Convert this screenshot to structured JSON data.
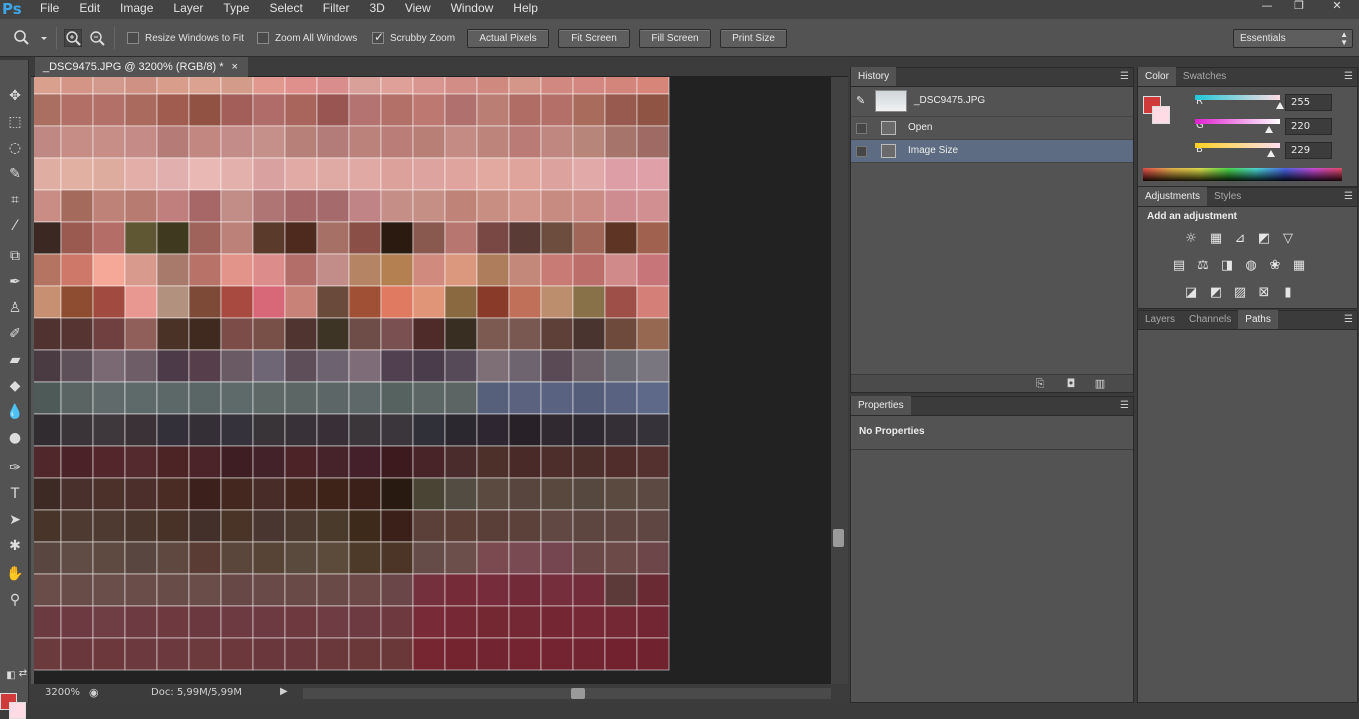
{
  "app": {
    "logo": "Ps"
  },
  "menu": [
    "File",
    "Edit",
    "Image",
    "Layer",
    "Type",
    "Select",
    "Filter",
    "3D",
    "View",
    "Window",
    "Help"
  ],
  "window_controls": {
    "minimize": "—",
    "restore": "❐",
    "close": "✕"
  },
  "options_bar": {
    "resize_windows_label": "Resize Windows to Fit",
    "resize_windows_checked": false,
    "zoom_all_label": "Zoom All Windows",
    "zoom_all_checked": false,
    "scrubby_zoom_label": "Scrubby Zoom",
    "scrubby_zoom_checked": true,
    "actual_pixels": "Actual Pixels",
    "fit_screen": "Fit Screen",
    "fill_screen": "Fill Screen",
    "print_size": "Print Size",
    "workspace": "Essentials"
  },
  "document": {
    "tab_title": "_DSC9475.JPG @ 3200% (RGB/8) *",
    "tab_close": "×",
    "zoom": "3200%",
    "doc_info": "Doc: 5,99M/5,99M"
  },
  "history_panel": {
    "tab": "History",
    "snapshot": "_DSC9475.JPG",
    "states": [
      {
        "label": "Open",
        "selected": false
      },
      {
        "label": "Image Size",
        "selected": true
      }
    ]
  },
  "properties_panel": {
    "tab": "Properties",
    "body": "No Properties"
  },
  "color_panel": {
    "tabs": [
      "Color",
      "Swatches"
    ],
    "foreground": "#d03a3a",
    "background": "#ffdce5",
    "r_label": "R",
    "r_value": "255",
    "g_label": "G",
    "g_value": "220",
    "b_label": "B",
    "b_value": "229"
  },
  "adjustments_panel": {
    "tabs": [
      "Adjustments",
      "Styles"
    ],
    "title": "Add an adjustment"
  },
  "layers_panel": {
    "tabs": [
      "Layers",
      "Channels",
      "Paths"
    ],
    "active_tab": "Paths"
  },
  "canvas_rows": [
    [
      "#d9a08e",
      "#d49586",
      "#d2998c",
      "#cf9183",
      "#d99d8c",
      "#dba292",
      "#d39b8a",
      "#e0988f",
      "#e0908c",
      "#d98e8d",
      "#d9a09a",
      "#dfa09a",
      "#d99690",
      "#d28d86",
      "#cf897f",
      "#d49688",
      "#d08881",
      "#d38780",
      "#d3847b",
      "#d88579"
    ],
    [
      "#ab6f62",
      "#b26f65",
      "#b37068",
      "#ab6a5e",
      "#a05c4f",
      "#925243",
      "#a35e5a",
      "#af6c68",
      "#a9645b",
      "#985551",
      "#b47270",
      "#b27068",
      "#bc7871",
      "#b0706e",
      "#bb7e74",
      "#b06d65",
      "#b47068",
      "#a96b5c",
      "#985a4e",
      "#8f5444"
    ],
    [
      "#c08883",
      "#c68d86",
      "#c68e86",
      "#c58b86",
      "#b57b76",
      "#c28781",
      "#c48c89",
      "#c58f8a",
      "#b7817a",
      "#b47c78",
      "#bb827c",
      "#bb7d77",
      "#b87f77",
      "#c48a84",
      "#bd847c",
      "#ba7b77",
      "#c08780",
      "#b8857a",
      "#a6746a",
      "#9e6a63"
    ],
    [
      "#e0ada3",
      "#e2b0a3",
      "#deab9f",
      "#e3ada8",
      "#e1b0ae",
      "#e9b8b4",
      "#e3b0ac",
      "#d9a2a0",
      "#e2aaa5",
      "#e0aaa4",
      "#e0a9a4",
      "#dba19a",
      "#dda39f",
      "#e0a49e",
      "#e2a9a1",
      "#dfa49c",
      "#dba29e",
      "#e1a9a8",
      "#de9ea6",
      "#e0a0a8"
    ],
    [
      "#c98d86",
      "#a46a5c",
      "#be8278",
      "#b87b72",
      "#c07f7c",
      "#a76767",
      "#c28d87",
      "#ae7574",
      "#a56767",
      "#a56a6b",
      "#c18486",
      "#c58f88",
      "#c68f85",
      "#bf8377",
      "#c88e82",
      "#d2958c",
      "#c88b82",
      "#c98b83",
      "#ce8c90",
      "#d18f92"
    ],
    [
      "#3b2822",
      "#9a5a50",
      "#b56e67",
      "#5f5633",
      "#3f391f",
      "#a0635b",
      "#bc8178",
      "#5a3a2a",
      "#4e2a1e",
      "#a77066",
      "#8a5048",
      "#2a1a10",
      "#89584f",
      "#b87670",
      "#7a4844",
      "#5a3b35",
      "#6c4d3e",
      "#a06658",
      "#5e3424",
      "#a0624e"
    ],
    [
      "#b57361",
      "#cd7868",
      "#f6a898",
      "#d89a8c",
      "#a87a6c",
      "#b87268",
      "#e2948a",
      "#dc8c8a",
      "#b46e6a",
      "#c28c88",
      "#b58464",
      "#b48052",
      "#d08a7e",
      "#dc987e",
      "#ad7d5c",
      "#c4887a",
      "#c87a74",
      "#bb6e6a",
      "#d08a8a",
      "#c8757a"
    ],
    [
      "#c89072",
      "#8e4c30",
      "#a04a40",
      "#e89890",
      "#b2927e",
      "#7e4a38",
      "#a84a40",
      "#d86878",
      "#c88278",
      "#6a4a3a",
      "#a05034",
      "#e07a60",
      "#e09478",
      "#8a6840",
      "#8a3a28",
      "#c07058",
      "#bc8e6e",
      "#887048",
      "#9e5048",
      "#d48078"
    ],
    [
      "#503230",
      "#563432",
      "#704040",
      "#905f5a",
      "#4a3226",
      "#402a20",
      "#7c4c48",
      "#785048",
      "#503430",
      "#3e3426",
      "#6e4c48",
      "#7a5050",
      "#4e2a28",
      "#382e22",
      "#7c5a52",
      "#785850",
      "#5e4038",
      "#4a3430",
      "#6e4a3c",
      "#966852"
    ],
    [
      "#4a3a42",
      "#5e5058",
      "#7a6872",
      "#6e5c66",
      "#4c3a48",
      "#563e4a",
      "#6a5a64",
      "#6e6674",
      "#5e4e5a",
      "#6c6270",
      "#7e6c78",
      "#504050",
      "#4a3c4a",
      "#564a58",
      "#7e6e76",
      "#6e6470",
      "#5a4a56",
      "#6c6068",
      "#6c6a72",
      "#7a7680"
    ],
    [
      "#4e5a58",
      "#5a6462",
      "#606a6a",
      "#5e6a6a",
      "#5c6868",
      "#5a6666",
      "#5e6a6a",
      "#5e6866",
      "#5c6664",
      "#5c6666",
      "#5e6868",
      "#566260",
      "#5c6664",
      "#5c6464",
      "#56607a",
      "#5a6280",
      "#5a6282",
      "#545e7a",
      "#5a6282",
      "#5e6888"
    ],
    [
      "#302c30",
      "#3a3438",
      "#3e383c",
      "#3a3236",
      "#34303a",
      "#342e36",
      "#36323c",
      "#383438",
      "#383238",
      "#383036",
      "#3a363a",
      "#3a363c",
      "#303038",
      "#2c2830",
      "#2e2630",
      "#282228",
      "#302a30",
      "#2e2830",
      "#342e36",
      "#36323a"
    ],
    [
      "#50282c",
      "#4a2228",
      "#52262a",
      "#542a2e",
      "#4c2426",
      "#4a2428",
      "#3e1e22",
      "#44222a",
      "#4c2428",
      "#46232a",
      "#44202a",
      "#3c1a1e",
      "#482428",
      "#4a2c2c",
      "#4e302a",
      "#4a2a28",
      "#4e2e2a",
      "#4c2e2a",
      "#502c2a",
      "#54302e"
    ],
    [
      "#3e2a24",
      "#4a302c",
      "#4c302a",
      "#4c2e2a",
      "#4a2c24",
      "#3c201c",
      "#442820",
      "#482c28",
      "#44261e",
      "#3e2418",
      "#3a2018",
      "#281a10",
      "#4a4434",
      "#524c42",
      "#5a4a40",
      "#58463e",
      "#58483e",
      "#56483e",
      "#5a4a40",
      "#5c4a42"
    ],
    [
      "#483428",
      "#4e3a30",
      "#4e3a30",
      "#4a362c",
      "#483228",
      "#44302a",
      "#4a3428",
      "#4a3630",
      "#4c3a30",
      "#4a3a2c",
      "#3e2a1a",
      "#3a2018",
      "#5a4038",
      "#5c4038",
      "#5a3e38",
      "#5c403a",
      "#624842",
      "#5e4640",
      "#604640",
      "#604642"
    ],
    [
      "#5a4640",
      "#604c44",
      "#5e4a40",
      "#5a4640",
      "#5e4840",
      "#5a3c34",
      "#5a463a",
      "#584436",
      "#5a4a3e",
      "#5c4a3a",
      "#4e3a28",
      "#4c3426",
      "#664c48",
      "#6c4e4a",
      "#7a4a50",
      "#7a4a52",
      "#764650",
      "#6a4848",
      "#6c4a48",
      "#6c4648"
    ],
    [
      "#6a4c48",
      "#684c48",
      "#6a4e4a",
      "#6a4c48",
      "#684c48",
      "#6a4c48",
      "#684846",
      "#6a4a48",
      "#6a4a46",
      "#6a4a46",
      "#6c4846",
      "#6a4648",
      "#74303c",
      "#762c38",
      "#762c3a",
      "#722a38",
      "#742e3c",
      "#722c3a",
      "#5c3a3a",
      "#6a2a34"
    ],
    [
      "#6a3a40",
      "#6e3a42",
      "#6e3e44",
      "#6e3a42",
      "#6e3a40",
      "#6c3840",
      "#6e3a42",
      "#6e3a42",
      "#6e3a40",
      "#6e3c42",
      "#6e3a42",
      "#6e3a40",
      "#782a36",
      "#762834",
      "#742832",
      "#742834",
      "#742632",
      "#762834",
      "#742834",
      "#722634"
    ],
    [
      "#6a3a3c",
      "#6a383c",
      "#6c383c",
      "#6c3a3e",
      "#6c3a3e",
      "#6c3a3c",
      "#6c383c",
      "#6a383c",
      "#6a383c",
      "#6a383a",
      "#6a3838",
      "#6a3838",
      "#762630",
      "#74242e",
      "#722430",
      "#742430",
      "#742430",
      "#722430",
      "#72222e",
      "#70222e"
    ]
  ]
}
